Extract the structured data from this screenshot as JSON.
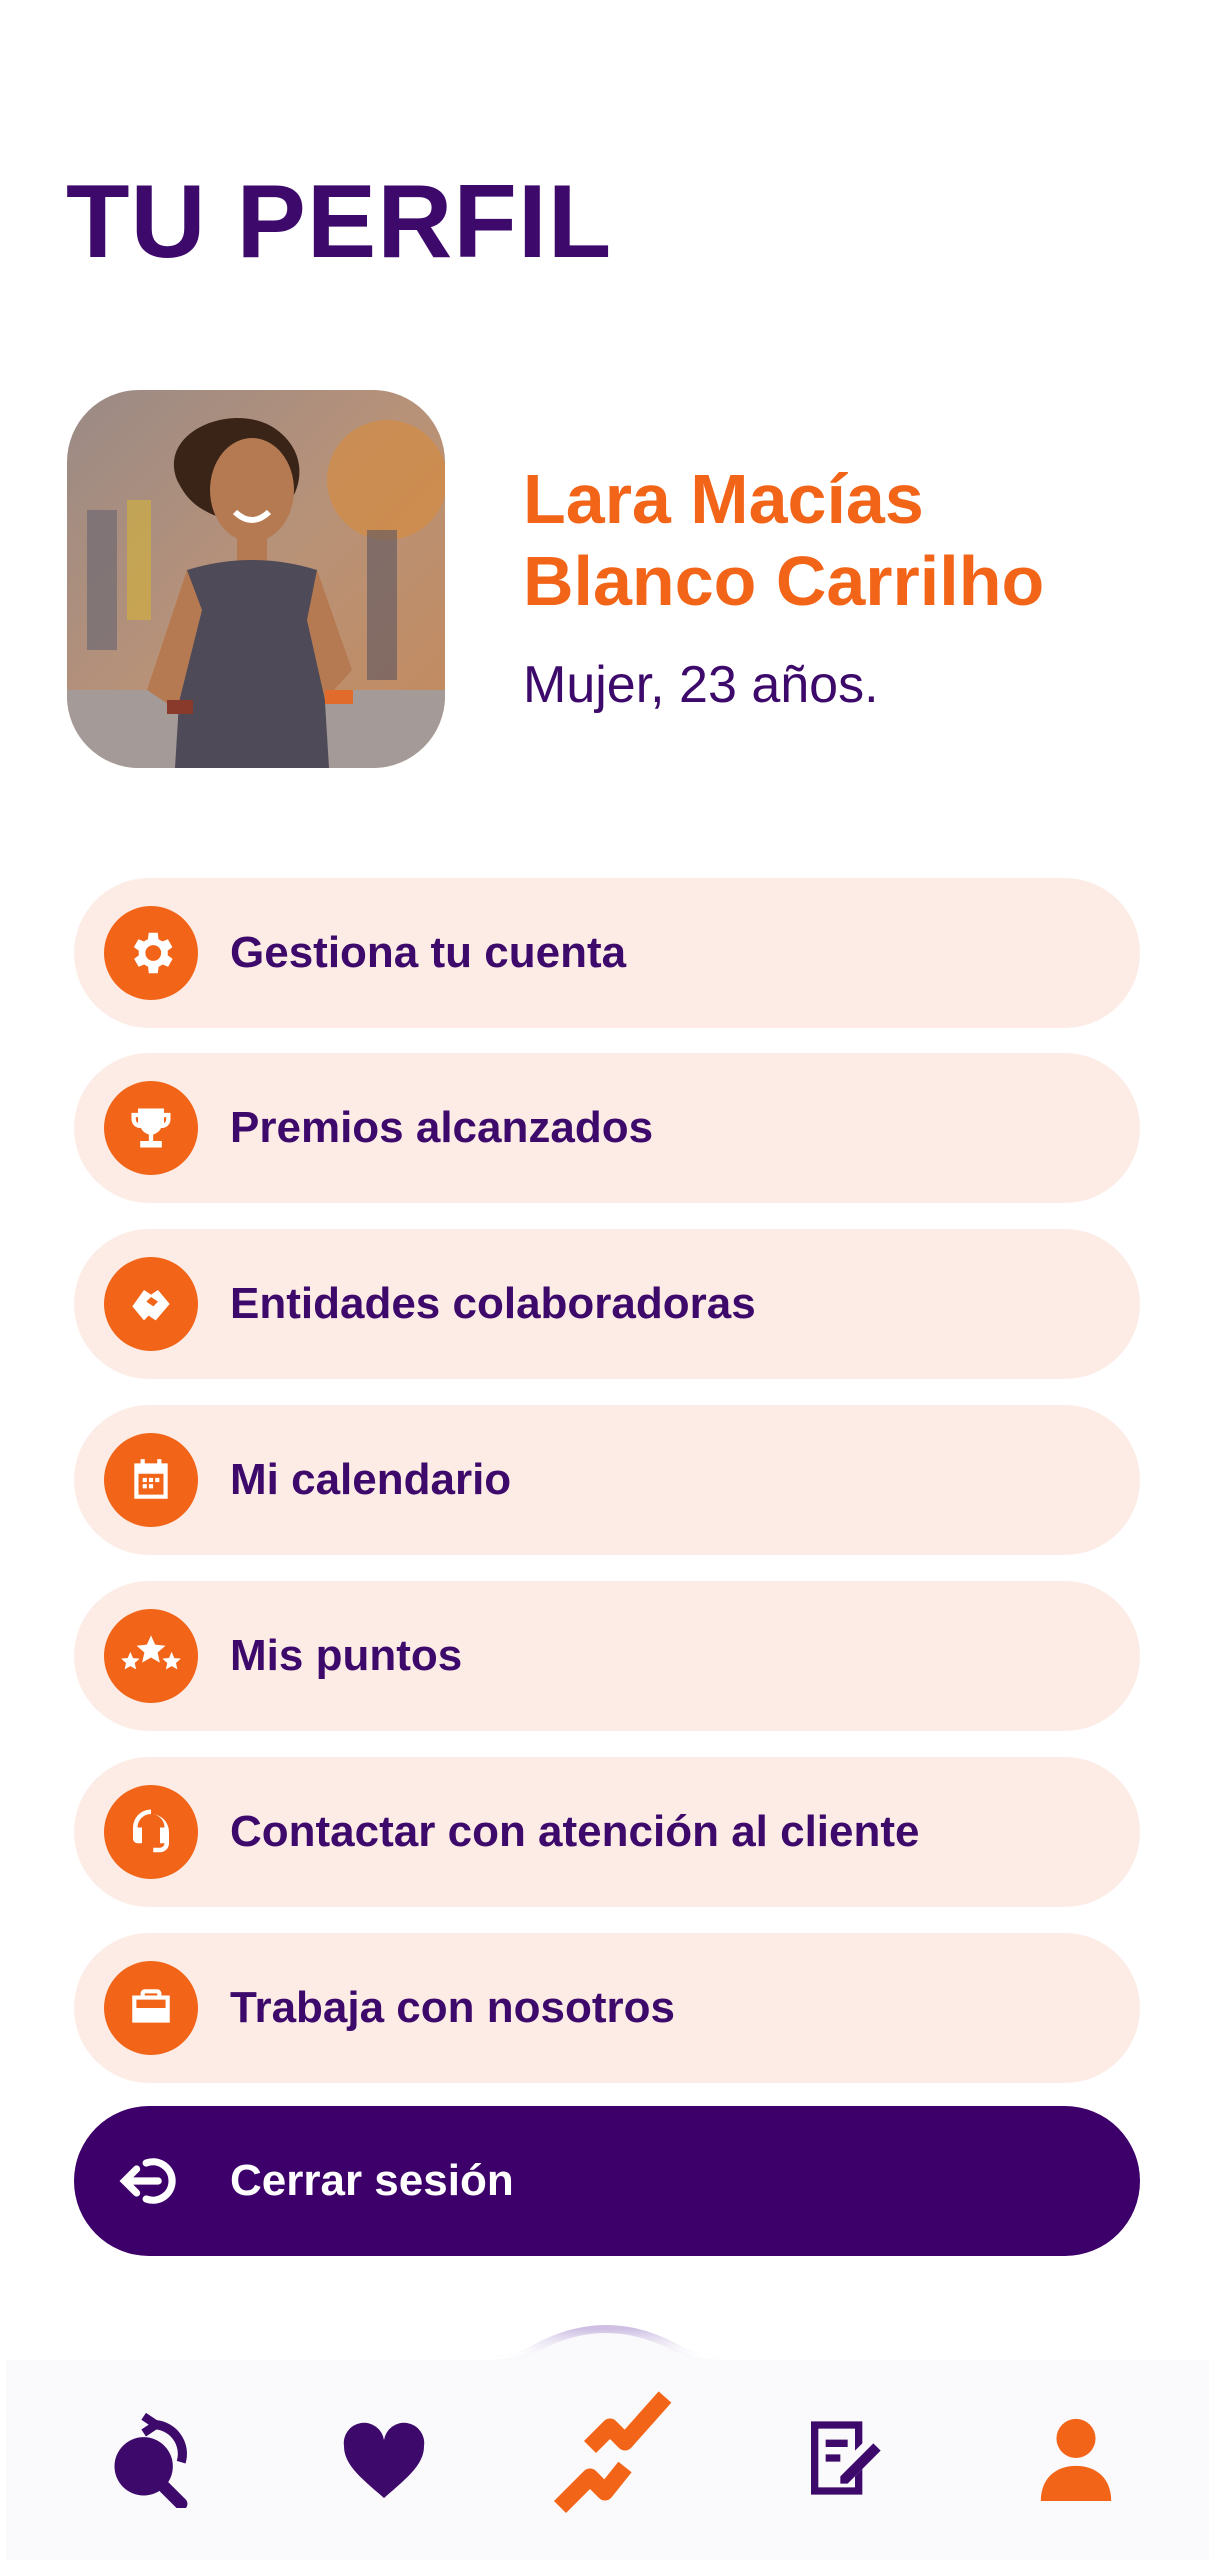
{
  "page": {
    "title": "TU PERFIL"
  },
  "profile": {
    "name_line1": "Lara Macías",
    "name_line2": "Blanco Carrilho",
    "meta": "Mujer, 23 años.",
    "avatar": "runner-photo"
  },
  "menu": [
    {
      "label": "Gestiona tu cuenta",
      "icon": "gear-icon"
    },
    {
      "label": "Premios alcanzados",
      "icon": "trophy-icon"
    },
    {
      "label": "Entidades colaboradoras",
      "icon": "handshake-icon"
    },
    {
      "label": "Mi calendario",
      "icon": "calendar-icon"
    },
    {
      "label": "Mis puntos",
      "icon": "stars-icon"
    },
    {
      "label": "Contactar con atención al cliente",
      "icon": "headset-icon"
    },
    {
      "label": "Trabaja con nosotros",
      "icon": "briefcase-icon"
    }
  ],
  "logout": {
    "label": "Cerrar sesión",
    "icon": "logout-icon"
  },
  "bottom_nav": [
    {
      "icon": "search-refresh-icon",
      "active": false
    },
    {
      "icon": "heart-icon",
      "active": false
    },
    {
      "icon": "runner-logo-icon",
      "active": true
    },
    {
      "icon": "edit-note-icon",
      "active": false
    },
    {
      "icon": "user-icon",
      "active": true
    }
  ],
  "colors": {
    "primary": "#3d0a6b",
    "accent": "#f26418",
    "item_bg": "#fdece6",
    "logout_bg": "#3d006b"
  }
}
